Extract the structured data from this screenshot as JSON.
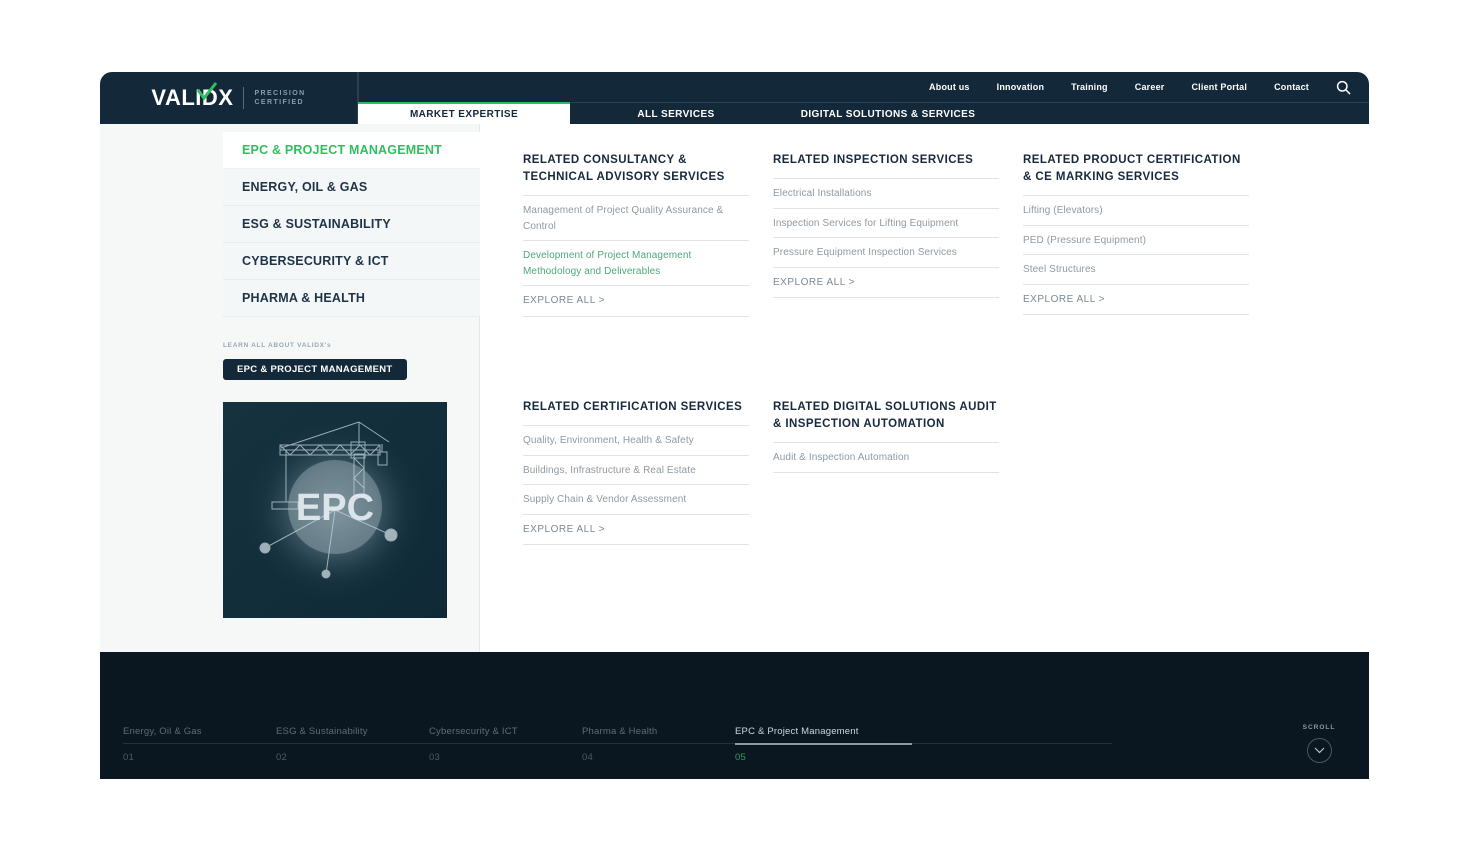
{
  "brand": {
    "name": "VALIDX",
    "tagline_line1": "PRECISION",
    "tagline_line2": "CERTIFIED",
    "accent_green": "#2fbf5f",
    "navy": "#13293a"
  },
  "header": {
    "top_links": [
      {
        "label": "About us"
      },
      {
        "label": "Innovation"
      },
      {
        "label": "Training"
      },
      {
        "label": "Career"
      },
      {
        "label": "Client Portal"
      },
      {
        "label": "Contact"
      }
    ],
    "search_icon": "search-icon",
    "tabs": [
      {
        "label": "MARKET EXPERTISE",
        "active": true
      },
      {
        "label": "ALL SERVICES",
        "active": false
      },
      {
        "label": "DIGITAL SOLUTIONS & SERVICES",
        "active": false
      }
    ]
  },
  "sidebar": {
    "items": [
      {
        "label": "EPC & PROJECT MANAGEMENT",
        "active": true
      },
      {
        "label": "ENERGY, OIL & GAS",
        "active": false
      },
      {
        "label": "ESG & SUSTAINABILITY",
        "active": false
      },
      {
        "label": "CYBERSECURITY & ICT",
        "active": false
      },
      {
        "label": "PHARMA & HEALTH",
        "active": false
      }
    ],
    "learn_label": "LEARN ALL ABOUT VALIDX's",
    "learn_chip": "EPC & PROJECT MANAGEMENT",
    "card_text": "EPC"
  },
  "columns": [
    {
      "title": "RELATED CONSULTANCY & TECHNICAL ADVISORY SERVICES",
      "items": [
        {
          "label": "Management of Project Quality Assurance & Control",
          "highlight": false
        },
        {
          "label": "Development of Project Management Methodology and Deliverables",
          "highlight": true
        }
      ],
      "explore": "EXPLORE ALL >"
    },
    {
      "title": "RELATED INSPECTION SERVICES",
      "items": [
        {
          "label": "Electrical Installations",
          "highlight": false
        },
        {
          "label": "Inspection Services for Lifting Equipment",
          "highlight": false
        },
        {
          "label": "Pressure Equipment Inspection Services",
          "highlight": false
        }
      ],
      "explore": "EXPLORE ALL >"
    },
    {
      "title": "RELATED PRODUCT CERTIFICATION & CE MARKING SERVICES",
      "items": [
        {
          "label": "Lifting (Elevators)",
          "highlight": false
        },
        {
          "label": "PED (Pressure Equipment)",
          "highlight": false
        },
        {
          "label": "Steel Structures",
          "highlight": false
        }
      ],
      "explore": "EXPLORE ALL >"
    },
    {
      "title": "RELATED CERTIFICATION SERVICES",
      "items": [
        {
          "label": "Quality, Environment, Health & Safety",
          "highlight": false
        },
        {
          "label": "Buildings, Infrastructure & Real Estate",
          "highlight": false
        },
        {
          "label": "Supply Chain & Vendor Assessment",
          "highlight": false
        }
      ],
      "explore": "EXPLORE ALL >"
    },
    {
      "title": "RELATED DIGITAL SOLUTIONS AUDIT & INSPECTION AUTOMATION",
      "items": [
        {
          "label": "Audit & Inspection Automation",
          "highlight": false
        }
      ],
      "explore": ""
    }
  ],
  "footer": {
    "pager": [
      {
        "label": "Energy, Oil & Gas",
        "number": "01",
        "active": false
      },
      {
        "label": "ESG & Sustainability",
        "number": "02",
        "active": false
      },
      {
        "label": "Cybersecurity & ICT",
        "number": "03",
        "active": false
      },
      {
        "label": "Pharma & Health",
        "number": "04",
        "active": false
      },
      {
        "label": "EPC & Project Management",
        "number": "05",
        "active": true
      }
    ],
    "scroll_label": "SCROLL",
    "scroll_icon": "chevron-down-icon"
  }
}
